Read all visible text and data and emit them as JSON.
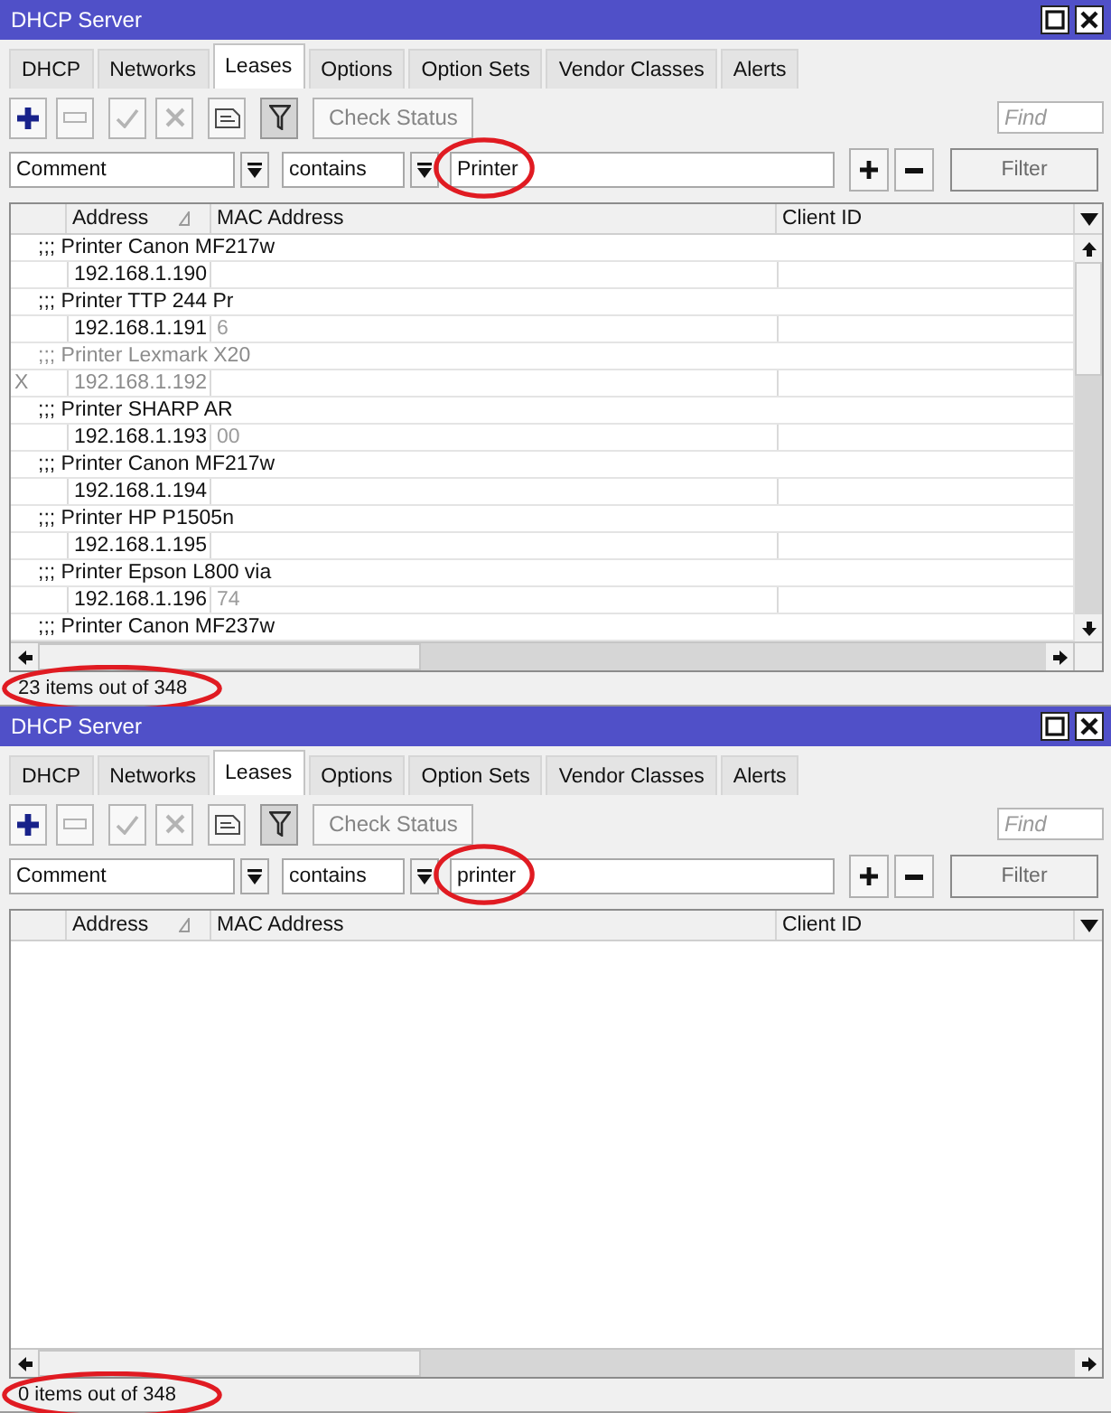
{
  "windows": [
    {
      "title": "DHCP Server",
      "tabs": [
        {
          "label": "DHCP",
          "selected": false
        },
        {
          "label": "Networks",
          "selected": false
        },
        {
          "label": "Leases",
          "selected": true
        },
        {
          "label": "Options",
          "selected": false
        },
        {
          "label": "Option Sets",
          "selected": false
        },
        {
          "label": "Vendor Classes",
          "selected": false
        },
        {
          "label": "Alerts",
          "selected": false
        }
      ],
      "toolbar": [
        {
          "kind": "add",
          "disabled": false,
          "pressed": false
        },
        {
          "kind": "remove",
          "disabled": true,
          "pressed": false
        },
        {
          "kind": "enable",
          "disabled": true,
          "pressed": false
        },
        {
          "kind": "disable",
          "disabled": true,
          "pressed": false
        },
        {
          "kind": "comment",
          "disabled": false,
          "pressed": false
        },
        {
          "kind": "filter",
          "disabled": false,
          "pressed": true
        }
      ],
      "check_status": {
        "label": "Check Status",
        "disabled": true
      },
      "find": {
        "placeholder": "Find"
      },
      "filter": {
        "property": "Comment",
        "operator": "contains",
        "value": "Printer",
        "value_highlighted": true,
        "apply_label": "Filter"
      },
      "table": {
        "columns": [
          {
            "label": "Address",
            "sorted": true
          },
          {
            "label": "MAC Address",
            "sorted": false
          },
          {
            "label": "Client ID",
            "sorted": false
          }
        ],
        "rows": [
          {
            "kind": "comment",
            "text": ";;; Printer Canon MF217w",
            "disabled": false
          },
          {
            "kind": "lease",
            "address": "192.168.1.190",
            "disabled": false
          },
          {
            "kind": "comment",
            "text": ";;; Printer TTP 244 Pr",
            "disabled": false
          },
          {
            "kind": "lease",
            "address": "192.168.1.191",
            "mac": "6",
            "disabled": false
          },
          {
            "kind": "comment",
            "text": ";;; Printer Lexmark X20",
            "disabled": true
          },
          {
            "kind": "lease",
            "flag": "X",
            "address": "192.168.1.192",
            "disabled": true
          },
          {
            "kind": "comment",
            "text": ";;; Printer SHARP AR",
            "disabled": false
          },
          {
            "kind": "lease",
            "address": "192.168.1.193",
            "mac": "00",
            "disabled": false
          },
          {
            "kind": "comment",
            "text": ";;; Printer Canon MF217w",
            "disabled": false
          },
          {
            "kind": "lease",
            "address": "192.168.1.194",
            "disabled": false
          },
          {
            "kind": "comment",
            "text": ";;; Printer HP P1505n",
            "disabled": false
          },
          {
            "kind": "lease",
            "address": "192.168.1.195",
            "disabled": false
          },
          {
            "kind": "comment",
            "text": ";;; Printer Epson L800 via",
            "disabled": false
          },
          {
            "kind": "lease",
            "address": "192.168.1.196",
            "mac": "74",
            "disabled": false
          },
          {
            "kind": "comment",
            "text": ";;; Printer Canon MF237w",
            "disabled": false
          }
        ]
      },
      "status": {
        "text": "23 items out of 348",
        "highlighted": true
      }
    },
    {
      "title": "DHCP Server",
      "tabs": [
        {
          "label": "DHCP",
          "selected": false
        },
        {
          "label": "Networks",
          "selected": false
        },
        {
          "label": "Leases",
          "selected": true
        },
        {
          "label": "Options",
          "selected": false
        },
        {
          "label": "Option Sets",
          "selected": false
        },
        {
          "label": "Vendor Classes",
          "selected": false
        },
        {
          "label": "Alerts",
          "selected": false
        }
      ],
      "toolbar": [
        {
          "kind": "add",
          "disabled": false,
          "pressed": false
        },
        {
          "kind": "remove",
          "disabled": true,
          "pressed": false
        },
        {
          "kind": "enable",
          "disabled": true,
          "pressed": false
        },
        {
          "kind": "disable",
          "disabled": true,
          "pressed": false
        },
        {
          "kind": "comment",
          "disabled": false,
          "pressed": false
        },
        {
          "kind": "filter",
          "disabled": false,
          "pressed": true
        }
      ],
      "check_status": {
        "label": "Check Status",
        "disabled": true
      },
      "find": {
        "placeholder": "Find"
      },
      "filter": {
        "property": "Comment",
        "operator": "contains",
        "value": "printer",
        "value_highlighted": true,
        "apply_label": "Filter"
      },
      "table": {
        "columns": [
          {
            "label": "Address",
            "sorted": true
          },
          {
            "label": "MAC Address",
            "sorted": false
          },
          {
            "label": "Client ID",
            "sorted": false
          }
        ]
      },
      "status": {
        "text": "0 items out of 348",
        "highlighted": true
      }
    }
  ]
}
